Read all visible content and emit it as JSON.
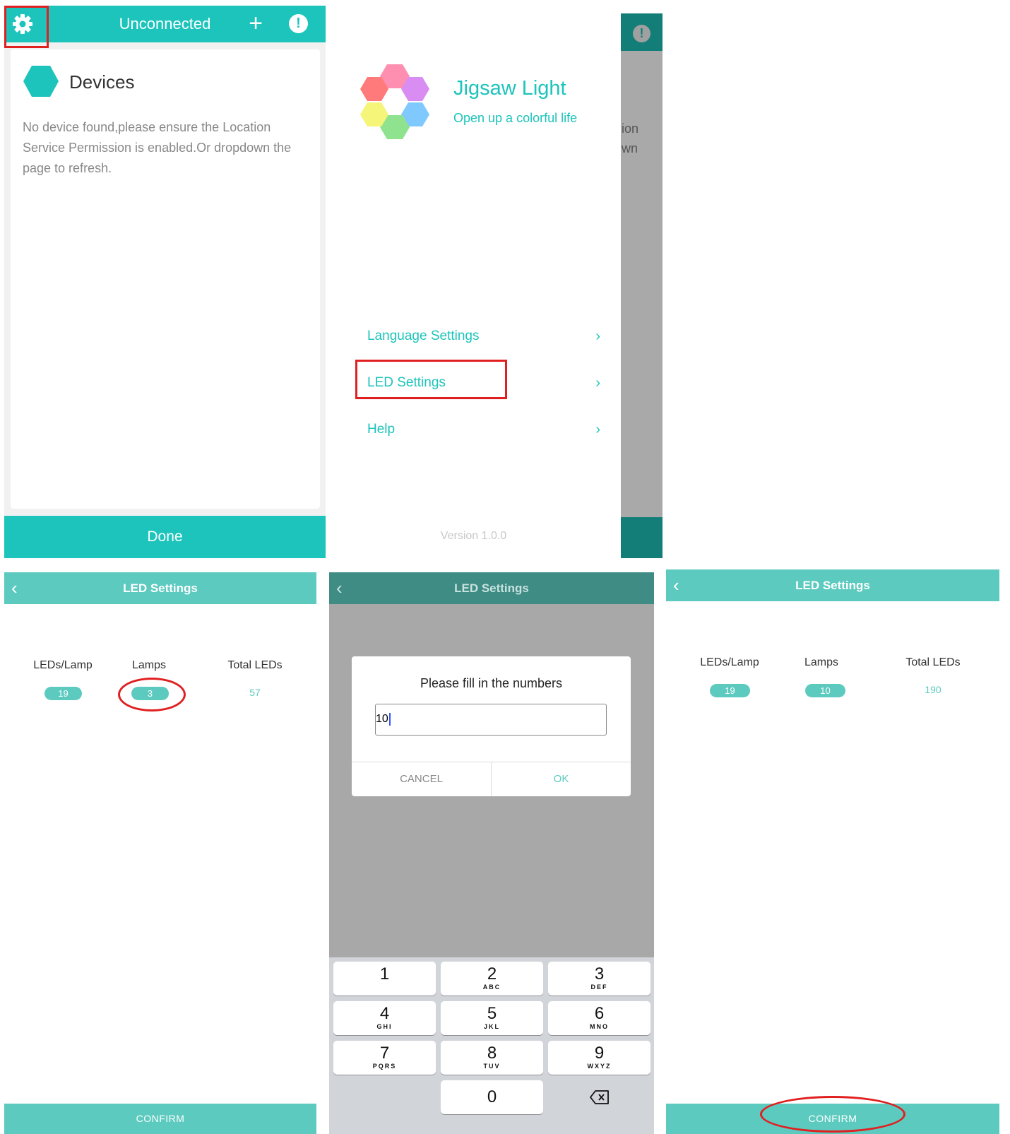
{
  "devices_screen": {
    "title": "Unconnected",
    "section_title": "Devices",
    "message": "No device found,please ensure the Location Service Permission is enabled.Or dropdown the page to refresh.",
    "done_label": "Done",
    "accent_color": "#1cc4bb"
  },
  "menu_screen": {
    "app_name": "Jigsaw Light",
    "tagline": "Open up a colorful life",
    "items": [
      {
        "label": "Language Settings"
      },
      {
        "label": "LED Settings"
      },
      {
        "label": "Help"
      }
    ],
    "version": "Version 1.0.0",
    "peek_text_1": "ion",
    "peek_text_2": "wn"
  },
  "led_before": {
    "title": "LED Settings",
    "columns": [
      "LEDs/Lamp",
      "Lamps",
      "Total LEDs"
    ],
    "leds_per_lamp": "19",
    "lamps": "3",
    "total_leds": "57",
    "confirm_label": "CONFIRM"
  },
  "dialog_screen": {
    "title": "LED Settings",
    "prompt": "Please fill in the numbers",
    "input_value": "10",
    "cancel_label": "CANCEL",
    "ok_label": "OK",
    "keys": [
      {
        "digit": "1",
        "letters": ""
      },
      {
        "digit": "2",
        "letters": "ABC"
      },
      {
        "digit": "3",
        "letters": "DEF"
      },
      {
        "digit": "4",
        "letters": "GHI"
      },
      {
        "digit": "5",
        "letters": "JKL"
      },
      {
        "digit": "6",
        "letters": "MNO"
      },
      {
        "digit": "7",
        "letters": "PQRS"
      },
      {
        "digit": "8",
        "letters": "TUV"
      },
      {
        "digit": "9",
        "letters": "WXYZ"
      },
      {
        "digit": "0",
        "letters": ""
      }
    ]
  },
  "led_after": {
    "title": "LED Settings",
    "columns": [
      "LEDs/Lamp",
      "Lamps",
      "Total LEDs"
    ],
    "leds_per_lamp": "19",
    "lamps": "10",
    "total_leds": "190",
    "confirm_label": "CONFIRM"
  }
}
